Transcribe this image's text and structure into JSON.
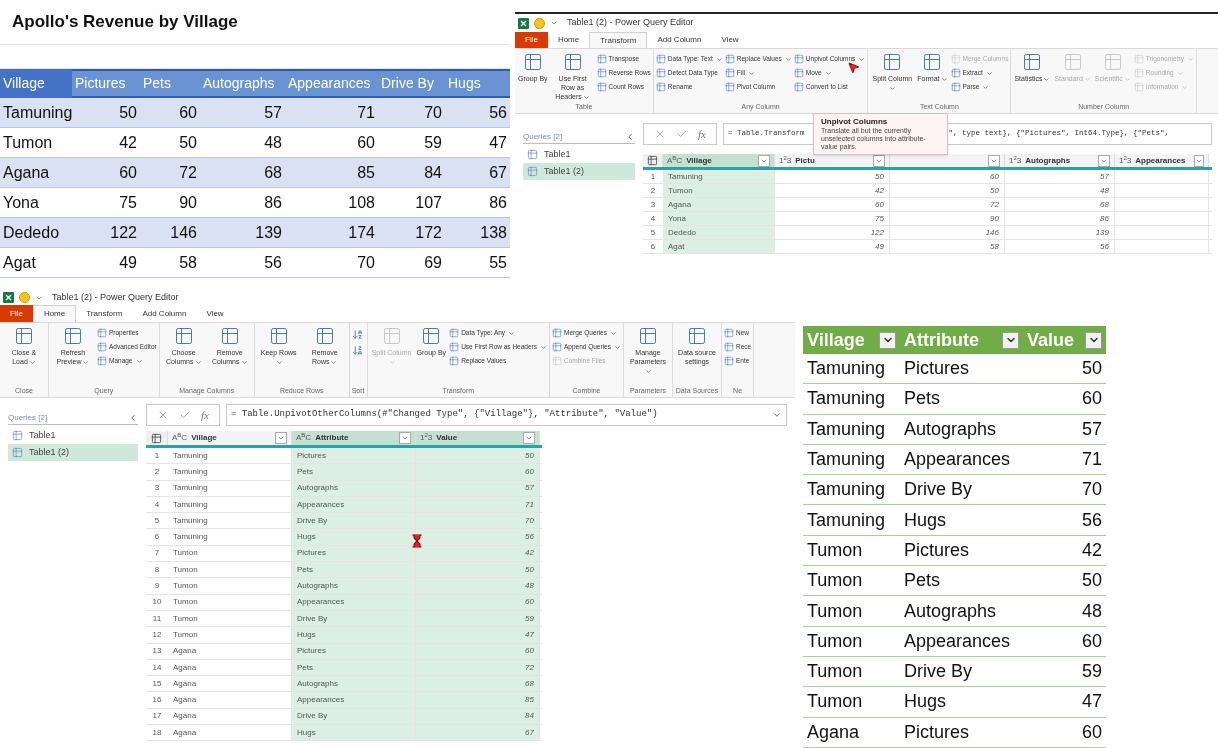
{
  "excel_source": {
    "title": "Apollo's Revenue by Village",
    "columns": [
      {
        "label": "Village",
        "selected": false
      },
      {
        "label": "Pictures",
        "selected": true
      },
      {
        "label": "Pets",
        "selected": true
      },
      {
        "label": "Autographs",
        "selected": true
      },
      {
        "label": "Appearances",
        "selected": true
      },
      {
        "label": "Drive By",
        "selected": true
      },
      {
        "label": "Hugs",
        "selected": true
      }
    ],
    "rows": [
      [
        "Tamuning",
        "50",
        "60",
        "57",
        "71",
        "70",
        "56"
      ],
      [
        "Tumon",
        "42",
        "50",
        "48",
        "60",
        "59",
        "47"
      ],
      [
        "Agana",
        "60",
        "72",
        "68",
        "85",
        "84",
        "67"
      ],
      [
        "Yona",
        "75",
        "90",
        "86",
        "108",
        "107",
        "86"
      ],
      [
        "Dededo",
        "122",
        "146",
        "139",
        "174",
        "172",
        "138"
      ],
      [
        "Agat",
        "49",
        "58",
        "56",
        "70",
        "69",
        "55"
      ]
    ]
  },
  "editor_transform": {
    "title": "Table1 (2) - Power Query Editor",
    "tabs": [
      {
        "label": "File",
        "kind": "file",
        "selected": false
      },
      {
        "label": "Home",
        "kind": "tab",
        "selected": false
      },
      {
        "label": "Transform",
        "kind": "tab",
        "selected": true
      },
      {
        "label": "Add Column",
        "kind": "tab",
        "selected": false
      },
      {
        "label": "View",
        "kind": "tab",
        "selected": false
      }
    ],
    "ribbon": [
      {
        "label": "Table",
        "items": [
          {
            "label": "Group By",
            "kind": "large",
            "disabled": false,
            "dropdown": false
          },
          {
            "label": "Use First Row as Headers",
            "kind": "large",
            "disabled": false,
            "dropdown": true
          },
          {
            "label": "Transpose",
            "kind": "small",
            "disabled": false,
            "dropdown": false
          },
          {
            "label": "Reverse Rows",
            "kind": "small",
            "disabled": false,
            "dropdown": false
          },
          {
            "label": "Count Rows",
            "kind": "small",
            "disabled": false,
            "dropdown": false
          }
        ]
      },
      {
        "label": "Any Column",
        "items": [
          {
            "label": "Data Type: Text",
            "kind": "small",
            "disabled": false,
            "dropdown": true
          },
          {
            "label": "Detect Data Type",
            "kind": "small",
            "disabled": false,
            "dropdown": false
          },
          {
            "label": "Rename",
            "kind": "small",
            "disabled": false,
            "dropdown": false
          },
          {
            "label": "Replace Values",
            "kind": "small",
            "disabled": false,
            "dropdown": true
          },
          {
            "label": "Fill",
            "kind": "small",
            "disabled": false,
            "dropdown": true
          },
          {
            "label": "Pivot Column",
            "kind": "small",
            "disabled": false,
            "dropdown": false
          },
          {
            "label": "Unpivot Columns",
            "kind": "small",
            "disabled": false,
            "dropdown": true
          },
          {
            "label": "Move",
            "kind": "small",
            "disabled": false,
            "dropdown": true
          },
          {
            "label": "Convert to List",
            "kind": "small",
            "disabled": false,
            "dropdown": false
          }
        ]
      },
      {
        "label": "Text Column",
        "items": [
          {
            "label": "Split Column",
            "kind": "large",
            "disabled": false,
            "dropdown": true
          },
          {
            "label": "Format",
            "kind": "large",
            "disabled": false,
            "dropdown": true
          },
          {
            "label": "Merge Columns",
            "kind": "small",
            "disabled": true,
            "dropdown": false
          },
          {
            "label": "Extract",
            "kind": "small",
            "disabled": false,
            "dropdown": true
          },
          {
            "label": "Parse",
            "kind": "small",
            "disabled": false,
            "dropdown": true
          }
        ]
      },
      {
        "label": "Number Column",
        "items": [
          {
            "label": "Statistics",
            "kind": "large",
            "disabled": false,
            "dropdown": true
          },
          {
            "label": "Standard",
            "kind": "large",
            "disabled": true,
            "dropdown": true
          },
          {
            "label": "Scientific",
            "kind": "large",
            "disabled": true,
            "dropdown": true
          },
          {
            "label": "Trigonometry",
            "kind": "small",
            "disabled": true,
            "dropdown": true
          },
          {
            "label": "Rounding",
            "kind": "small",
            "disabled": true,
            "dropdown": true
          },
          {
            "label": "Information",
            "kind": "small",
            "disabled": true,
            "dropdown": true
          }
        ]
      }
    ],
    "queries": {
      "header": "Queries [2]",
      "items": [
        {
          "label": "Table1",
          "selected": false
        },
        {
          "label": "Table1 (2)",
          "selected": true
        }
      ]
    },
    "formula": {
      "fx": "fx",
      "parts": [
        "= Table.Transform",
        "\", type text}, {\"Pictures\", Int64.Type}, {\"Pets\","
      ]
    },
    "tooltip": {
      "title": "Unpivot Columns",
      "text": "Translate all but the currently unselected columns into attribute-value pairs."
    },
    "grid": {
      "columns": [
        {
          "label": "Village",
          "type_icon": "A$^{B}$C",
          "kind": "text",
          "selected": true
        },
        {
          "label": "Pictu",
          "type_icon": "1$^{2}$3",
          "kind": "number",
          "selected": false
        },
        {
          "kind": "number",
          "selected": false
        },
        {
          "label": "Autographs",
          "type_icon": "1$^{2}$3",
          "kind": "number",
          "selected": false
        },
        {
          "label": "Appearances",
          "type_icon": "1$^{2}$3",
          "kind": "number",
          "selected": false
        }
      ],
      "rows": [
        {
          "num": "1",
          "cells": [
            "Tamuning",
            "50",
            "60",
            "57"
          ]
        },
        {
          "num": "2",
          "cells": [
            "Tumon",
            "42",
            "50",
            "48"
          ]
        },
        {
          "num": "3",
          "cells": [
            "Agana",
            "60",
            "72",
            "68"
          ]
        },
        {
          "num": "4",
          "cells": [
            "Yona",
            "75",
            "90",
            "86"
          ]
        },
        {
          "num": "5",
          "cells": [
            "Dededo",
            "122",
            "146",
            "139"
          ]
        },
        {
          "num": "6",
          "cells": [
            "Agat",
            "49",
            "58",
            "56"
          ]
        }
      ]
    }
  },
  "editor_home": {
    "title": "Table1 (2) - Power Query Editor",
    "tabs": [
      {
        "label": "File",
        "kind": "file",
        "selected": false
      },
      {
        "label": "Home",
        "kind": "tab",
        "selected": true
      },
      {
        "label": "Transform",
        "kind": "tab",
        "selected": false
      },
      {
        "label": "Add Column",
        "kind": "tab",
        "selected": false
      },
      {
        "label": "View",
        "kind": "tab",
        "selected": false
      }
    ],
    "ribbon": [
      {
        "label": "Close",
        "items": [
          {
            "label": "Close & Load",
            "kind": "large",
            "disabled": false,
            "dropdown": true
          }
        ]
      },
      {
        "label": "Query",
        "items": [
          {
            "label": "Refresh Preview",
            "kind": "large",
            "disabled": false,
            "dropdown": true
          },
          {
            "label": "Properties",
            "kind": "small",
            "disabled": false,
            "dropdown": false
          },
          {
            "label": "Advanced Editor",
            "kind": "small",
            "disabled": false,
            "dropdown": false
          },
          {
            "label": "Manage",
            "kind": "small",
            "disabled": false,
            "dropdown": true
          }
        ]
      },
      {
        "label": "Manage Columns",
        "items": [
          {
            "label": "Choose Columns",
            "kind": "large",
            "disabled": false,
            "dropdown": true
          },
          {
            "label": "Remove Columns",
            "kind": "large",
            "disabled": false,
            "dropdown": true
          }
        ]
      },
      {
        "label": "Reduce Rows",
        "items": [
          {
            "label": "Keep Rows",
            "kind": "large",
            "disabled": false,
            "dropdown": true
          },
          {
            "label": "Remove Rows",
            "kind": "large",
            "disabled": false,
            "dropdown": true
          }
        ]
      },
      {
        "label": "Sort",
        "items": [
          {
            "kind": "icon",
            "disabled": false,
            "dropdown": false
          },
          {
            "kind": "icon",
            "disabled": false,
            "dropdown": false
          }
        ]
      },
      {
        "label": "Transform",
        "items": [
          {
            "label": "Split Column",
            "kind": "large",
            "disabled": true,
            "dropdown": true
          },
          {
            "label": "Group By",
            "kind": "large",
            "disabled": false,
            "dropdown": false
          },
          {
            "label": "Data Type: Any",
            "kind": "small",
            "disabled": false,
            "dropdown": true
          },
          {
            "label": "Use First Row as Headers",
            "kind": "small",
            "disabled": false,
            "dropdown": true
          },
          {
            "label": "Replace Values",
            "kind": "small",
            "disabled": false,
            "dropdown": false
          }
        ]
      },
      {
        "label": "Combine",
        "items": [
          {
            "label": "Merge Queries",
            "kind": "small",
            "disabled": false,
            "dropdown": true
          },
          {
            "label": "Append Queries",
            "kind": "small",
            "disabled": false,
            "dropdown": true
          },
          {
            "label": "Combine Files",
            "kind": "small",
            "disabled": true,
            "dropdown": false
          }
        ]
      },
      {
        "label": "Parameters",
        "items": [
          {
            "label": "Manage Parameters",
            "kind": "large",
            "disabled": false,
            "dropdown": true
          }
        ]
      },
      {
        "label": "Data Sources",
        "items": [
          {
            "label": "Data source settings",
            "kind": "large",
            "disabled": false,
            "dropdown": false
          }
        ]
      },
      {
        "label": "Ne",
        "items": [
          {
            "label": "New",
            "kind": "small",
            "disabled": false,
            "dropdown": false
          },
          {
            "label": "Rece",
            "kind": "small",
            "disabled": false,
            "dropdown": false
          },
          {
            "label": "Ente",
            "kind": "small",
            "disabled": false,
            "dropdown": false
          }
        ]
      }
    ],
    "queries": {
      "header": "Queries [2]",
      "items": [
        {
          "label": "Table1",
          "selected": false
        },
        {
          "label": "Table1 (2)",
          "selected": true
        }
      ]
    },
    "formula": {
      "fx": "fx",
      "parts": [
        "= Table.UnpivotOtherColumns(#\"Changed Type\", {\"Village\"}, \"Attribute\", \"Value\")"
      ]
    },
    "grid": {
      "columns": [
        {
          "label": "Village",
          "type_icon": "A$^{B}$C",
          "kind": "text",
          "selected": false
        },
        {
          "label": "Attribute",
          "type_icon": "A$^{B}$C",
          "kind": "text",
          "selected": true
        },
        {
          "label": "Value",
          "type_icon": "1$^{2}$3",
          "kind": "number",
          "selected": true
        }
      ],
      "rows": [
        {
          "num": "1",
          "cells": [
            "Tamuning",
            "Pictures",
            "50"
          ]
        },
        {
          "num": "2",
          "cells": [
            "Tamuning",
            "Pets",
            "60"
          ]
        },
        {
          "num": "3",
          "cells": [
            "Tamuning",
            "Autographs",
            "57"
          ]
        },
        {
          "num": "4",
          "cells": [
            "Tamuning",
            "Appearances",
            "71"
          ]
        },
        {
          "num": "5",
          "cells": [
            "Tamuning",
            "Drive By",
            "70"
          ]
        },
        {
          "num": "6",
          "cells": [
            "Tamuning",
            "Hugs",
            "56"
          ]
        },
        {
          "num": "7",
          "cells": [
            "Tumon",
            "Pictures",
            "42"
          ]
        },
        {
          "num": "8",
          "cells": [
            "Tumon",
            "Pets",
            "50"
          ]
        },
        {
          "num": "9",
          "cells": [
            "Tumon",
            "Autographs",
            "48"
          ]
        },
        {
          "num": "10",
          "cells": [
            "Tumon",
            "Appearances",
            "60"
          ]
        },
        {
          "num": "11",
          "cells": [
            "Tumon",
            "Drive By",
            "59"
          ]
        },
        {
          "num": "12",
          "cells": [
            "Tumon",
            "Hugs",
            "47"
          ]
        },
        {
          "num": "13",
          "cells": [
            "Agana",
            "Pictures",
            "60"
          ]
        },
        {
          "num": "14",
          "cells": [
            "Agana",
            "Pets",
            "72"
          ]
        },
        {
          "num": "15",
          "cells": [
            "Agana",
            "Autographs",
            "68"
          ]
        },
        {
          "num": "16",
          "cells": [
            "Agana",
            "Appearances",
            "85"
          ]
        },
        {
          "num": "17",
          "cells": [
            "Agana",
            "Drive By",
            "84"
          ]
        },
        {
          "num": "18",
          "cells": [
            "Agana",
            "Hugs",
            "67"
          ]
        }
      ]
    }
  },
  "excel_result": {
    "columns": [
      {
        "label": "Village"
      },
      {
        "label": "Attribute"
      },
      {
        "label": "Value"
      }
    ],
    "rows": [
      [
        "Tamuning",
        "Pictures",
        "50"
      ],
      [
        "Tamuning",
        "Pets",
        "60"
      ],
      [
        "Tamuning",
        "Autographs",
        "57"
      ],
      [
        "Tamuning",
        "Appearances",
        "71"
      ],
      [
        "Tamuning",
        "Drive By",
        "70"
      ],
      [
        "Tamuning",
        "Hugs",
        "56"
      ],
      [
        "Tumon",
        "Pictures",
        "42"
      ],
      [
        "Tumon",
        "Pets",
        "50"
      ],
      [
        "Tumon",
        "Autographs",
        "48"
      ],
      [
        "Tumon",
        "Appearances",
        "60"
      ],
      [
        "Tumon",
        "Drive By",
        "59"
      ],
      [
        "Tumon",
        "Hugs",
        "47"
      ],
      [
        "Agana",
        "Pictures",
        "60"
      ]
    ]
  }
}
